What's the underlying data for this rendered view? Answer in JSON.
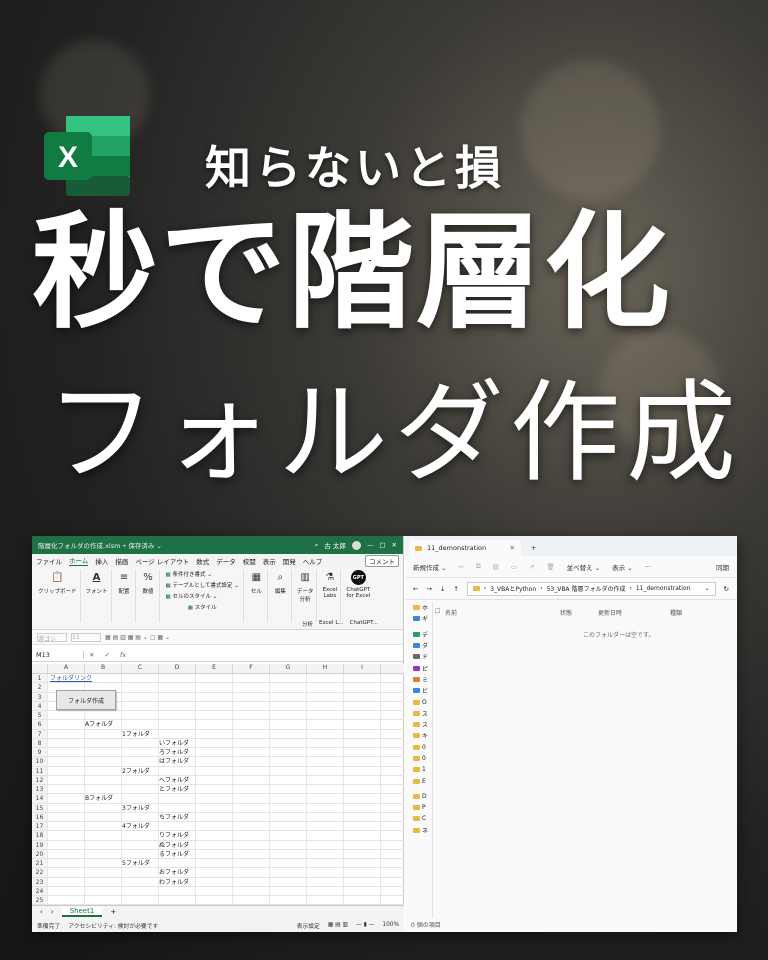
{
  "hero": {
    "subtitle": "知らないと損",
    "title_line1": "秒で階層化",
    "title_line2": "フォルダ作成",
    "logo_letter": "X"
  },
  "excel": {
    "title": "階層化フォルダの作成.xlsm • 保存済み ⌄",
    "search_icon": "search-icon",
    "user": "古 太郎",
    "window_controls": [
      "—",
      "□",
      "✕"
    ],
    "menu": [
      "ファイル",
      "ホーム",
      "挿入",
      "描画",
      "ページ レイアウト",
      "数式",
      "データ",
      "校閲",
      "表示",
      "開発",
      "ヘルプ"
    ],
    "menu_active": "ホーム",
    "comment_label": "コメント",
    "ribbon": {
      "groups": [
        {
          "label": "クリップボード",
          "icon": "clipboard-icon"
        },
        {
          "label": "フォント",
          "icon": "font-icon"
        },
        {
          "label": "配置",
          "icon": "align-icon"
        },
        {
          "label": "数値",
          "icon": "percent-icon"
        }
      ],
      "styles": [
        "条件付き書式 ⌄",
        "テーブルとして書式設定 ⌄",
        "セルのスタイル ⌄"
      ],
      "styles_label": "スタイル",
      "groups2": [
        {
          "label": "セル",
          "icon": "cells-icon"
        },
        {
          "label": "編集",
          "icon": "search-icon"
        },
        {
          "label": "データ\n分析",
          "icon": "data-analysis-icon"
        },
        {
          "label": "Excel\nLabs",
          "icon": "flask-icon"
        }
      ],
      "gpt_label": "ChatGPT\nfor Excel",
      "gpt_badge": "GPT",
      "bottom_labels": [
        "分析",
        "Excel L...",
        "ChatGPT..."
      ]
    },
    "format_bar": {
      "font_box": "游ゴシ",
      "size_box": "11"
    },
    "name_box": "M13",
    "formula_icons": [
      "✕",
      "✓",
      "fx"
    ],
    "columns": [
      "A",
      "B",
      "C",
      "D",
      "E",
      "F",
      "G",
      "H",
      "I"
    ],
    "rows": [
      [
        "1",
        "フォルダリンク",
        "",
        "",
        "",
        "",
        "",
        "",
        "",
        ""
      ],
      [
        "2",
        "",
        "",
        "",
        "",
        "",
        "",
        "",
        "",
        ""
      ],
      [
        "3",
        "",
        "",
        "",
        "",
        "",
        "",
        "",
        "",
        ""
      ],
      [
        "4",
        "",
        "",
        "",
        "",
        "",
        "",
        "",
        "",
        ""
      ],
      [
        "5",
        "",
        "",
        "",
        "",
        "",
        "",
        "",
        "",
        ""
      ],
      [
        "6",
        "",
        "Aフォルダ",
        "",
        "",
        "",
        "",
        "",
        "",
        ""
      ],
      [
        "7",
        "",
        "",
        "1フォルダ",
        "",
        "",
        "",
        "",
        "",
        ""
      ],
      [
        "8",
        "",
        "",
        "",
        "いフォルダ",
        "",
        "",
        "",
        "",
        ""
      ],
      [
        "9",
        "",
        "",
        "",
        "ろフォルダ",
        "",
        "",
        "",
        "",
        ""
      ],
      [
        "10",
        "",
        "",
        "",
        "はフォルダ",
        "",
        "",
        "",
        "",
        ""
      ],
      [
        "11",
        "",
        "",
        "2フォルダ",
        "",
        "",
        "",
        "",
        "",
        ""
      ],
      [
        "12",
        "",
        "",
        "",
        "へフォルダ",
        "",
        "",
        "",
        "",
        ""
      ],
      [
        "13",
        "",
        "",
        "",
        "とフォルダ",
        "",
        "",
        "",
        "",
        ""
      ],
      [
        "14",
        "",
        "Bフォルダ",
        "",
        "",
        "",
        "",
        "",
        "",
        ""
      ],
      [
        "15",
        "",
        "",
        "3フォルダ",
        "",
        "",
        "",
        "",
        "",
        ""
      ],
      [
        "16",
        "",
        "",
        "",
        "ちフォルダ",
        "",
        "",
        "",
        "",
        ""
      ],
      [
        "17",
        "",
        "",
        "4フォルダ",
        "",
        "",
        "",
        "",
        "",
        ""
      ],
      [
        "18",
        "",
        "",
        "",
        "りフォルダ",
        "",
        "",
        "",
        "",
        ""
      ],
      [
        "19",
        "",
        "",
        "",
        "ぬフォルダ",
        "",
        "",
        "",
        "",
        ""
      ],
      [
        "20",
        "",
        "",
        "",
        "るフォルダ",
        "",
        "",
        "",
        "",
        ""
      ],
      [
        "21",
        "",
        "",
        "5フォルダ",
        "",
        "",
        "",
        "",
        "",
        ""
      ],
      [
        "22",
        "",
        "",
        "",
        "おフォルダ",
        "",
        "",
        "",
        "",
        ""
      ],
      [
        "23",
        "",
        "",
        "",
        "わフォルダ",
        "",
        "",
        "",
        "",
        ""
      ],
      [
        "24",
        "",
        "",
        "",
        "",
        "",
        "",
        "",
        "",
        ""
      ],
      [
        "25",
        "",
        "",
        "",
        "",
        "",
        "",
        "",
        "",
        ""
      ]
    ],
    "button_label": "フォルダ作成",
    "sheet_tab": "Sheet1",
    "add_sheet": "+",
    "status": {
      "ready": "準備完了",
      "accessibility": "アクセシビリティ: 検討が必要です",
      "display": "表示設定",
      "zoom": "100%"
    }
  },
  "explorer": {
    "tab_title": "11_demonstration",
    "new_tab": "+",
    "toolbar": {
      "new": "新規作成 ⌄",
      "sort": "並べ替え ⌄",
      "view": "表示 ⌄",
      "more": "···",
      "share": "同期"
    },
    "address": [
      "3_VBAとPython",
      "53_VBA 階層フォルダの作成",
      "11_demonstration"
    ],
    "nav": [
      "←",
      "→",
      "↓",
      "↑"
    ],
    "sidebar": [
      "ホ",
      "ギ",
      "デ",
      "ダ",
      "ド",
      "ピ",
      "ミ",
      "ビ",
      "O",
      "ス",
      "ス",
      "キ",
      "0",
      "0",
      "1",
      "E",
      "D",
      "P",
      "C",
      "ネ"
    ],
    "columns": [
      "名前",
      "状態",
      "更新日時",
      "種類"
    ],
    "empty_message": "このフォルダーは空です。",
    "status": "0 個の項目"
  }
}
